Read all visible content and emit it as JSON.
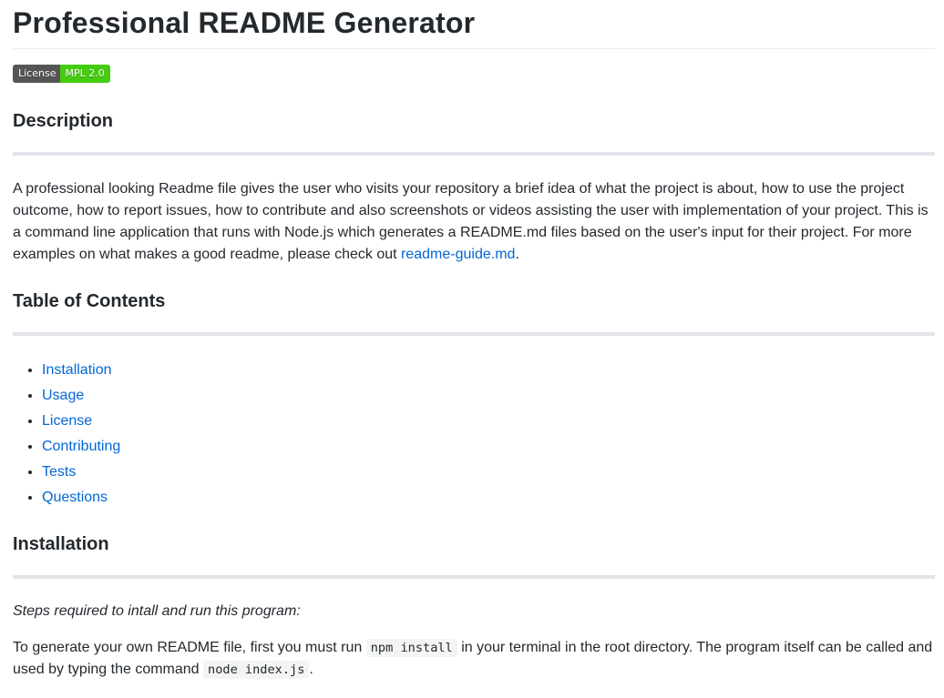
{
  "title": "Professional README Generator",
  "badge": {
    "left": "License",
    "right": "MPL 2.0",
    "left_color": "#555555",
    "right_color": "#44cc11"
  },
  "description": {
    "heading": "Description",
    "text": "A professional looking Readme file gives the user who visits your repository a brief idea of what the project is about, how to use the project outcome, how to report issues, how to contribute and also screenshots or videos assisting the user with implementation of your project. This is a command line application that runs with Node.js which generates a README.md files based on the user's input for their project. For more examples on what makes a good readme, please check out ",
    "link_text": "readme-guide.md",
    "trailing": "."
  },
  "toc": {
    "heading": "Table of Contents",
    "items": [
      "Installation",
      "Usage",
      "License",
      "Contributing",
      "Tests",
      "Questions"
    ]
  },
  "installation": {
    "heading": "Installation",
    "intro": "Steps required to intall and run this program:",
    "text_before": "To generate your own README file, first you must run ",
    "code1": "npm install",
    "text_middle": " in your terminal in the root directory. The program itself can be called and used by typing the command ",
    "code2": "node index.js",
    "trailing": "."
  },
  "colors": {
    "link": "#0366d6",
    "text": "#24292e",
    "rule": "#e1e4e8"
  }
}
